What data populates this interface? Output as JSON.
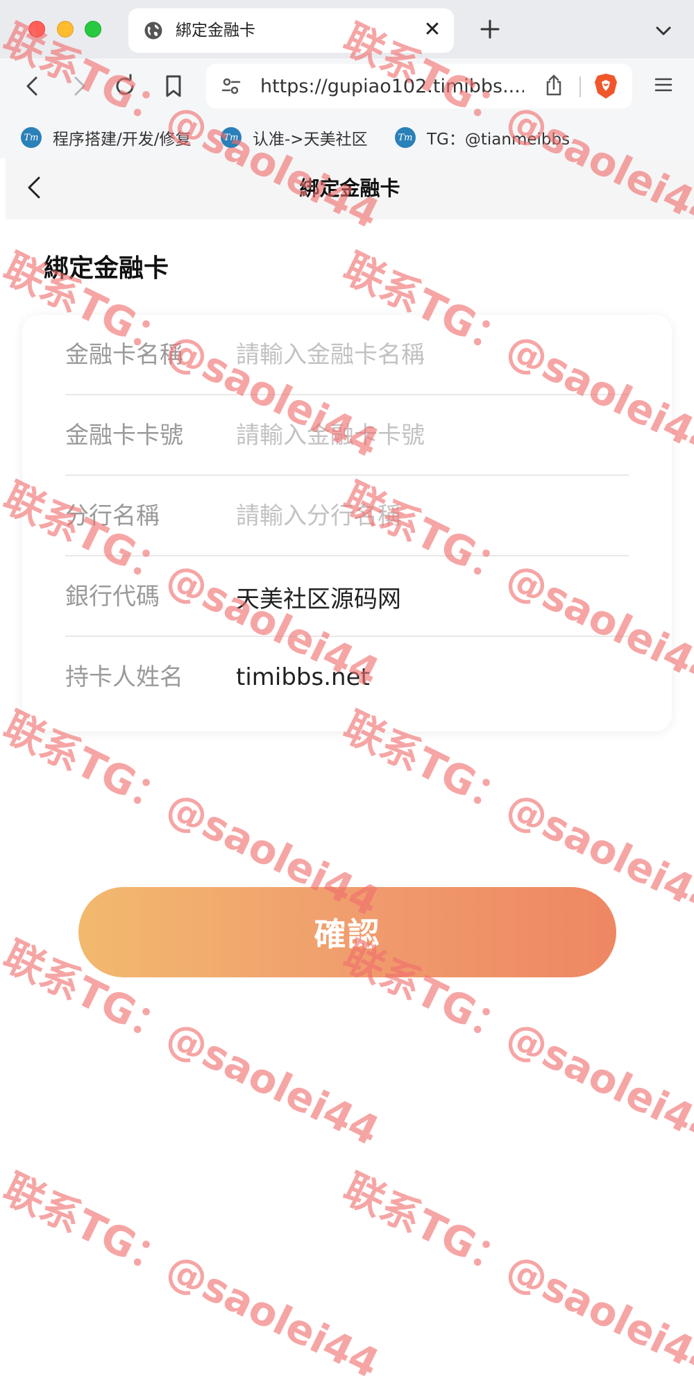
{
  "browser": {
    "tab_title": "綁定金融卡",
    "tab_close_glyph": "✕",
    "url": "https://gupiao102.timibbs....",
    "bookmarks": [
      {
        "label": "程序搭建/开发/修复",
        "icon_text": "Tm"
      },
      {
        "label": "认准->天美社区",
        "icon_text": "Tm"
      },
      {
        "label": "TG：@tianmeibbs",
        "icon_text": "Tm"
      }
    ]
  },
  "header": {
    "title": "綁定金融卡"
  },
  "section_title": "綁定金融卡",
  "form": {
    "fields": [
      {
        "label": "金融卡名稱",
        "placeholder": "請輸入金融卡名稱",
        "value": ""
      },
      {
        "label": "金融卡卡號",
        "placeholder": "請輸入金融卡卡號",
        "value": ""
      },
      {
        "label": "分行名稱",
        "placeholder": "請輸入分行名稱",
        "value": ""
      },
      {
        "label": "銀行代碼",
        "placeholder": "",
        "value": "天美社区源码网"
      },
      {
        "label": "持卡人姓名",
        "placeholder": "",
        "value": "timibbs.net"
      }
    ]
  },
  "confirm_label": "確認",
  "watermark": "联系TG：@saolei44",
  "colors": {
    "accent_start": "#f2b96e",
    "accent_end": "#ee8763",
    "watermark": "#f06e6e",
    "bookmark_icon": "#2a80b9"
  }
}
